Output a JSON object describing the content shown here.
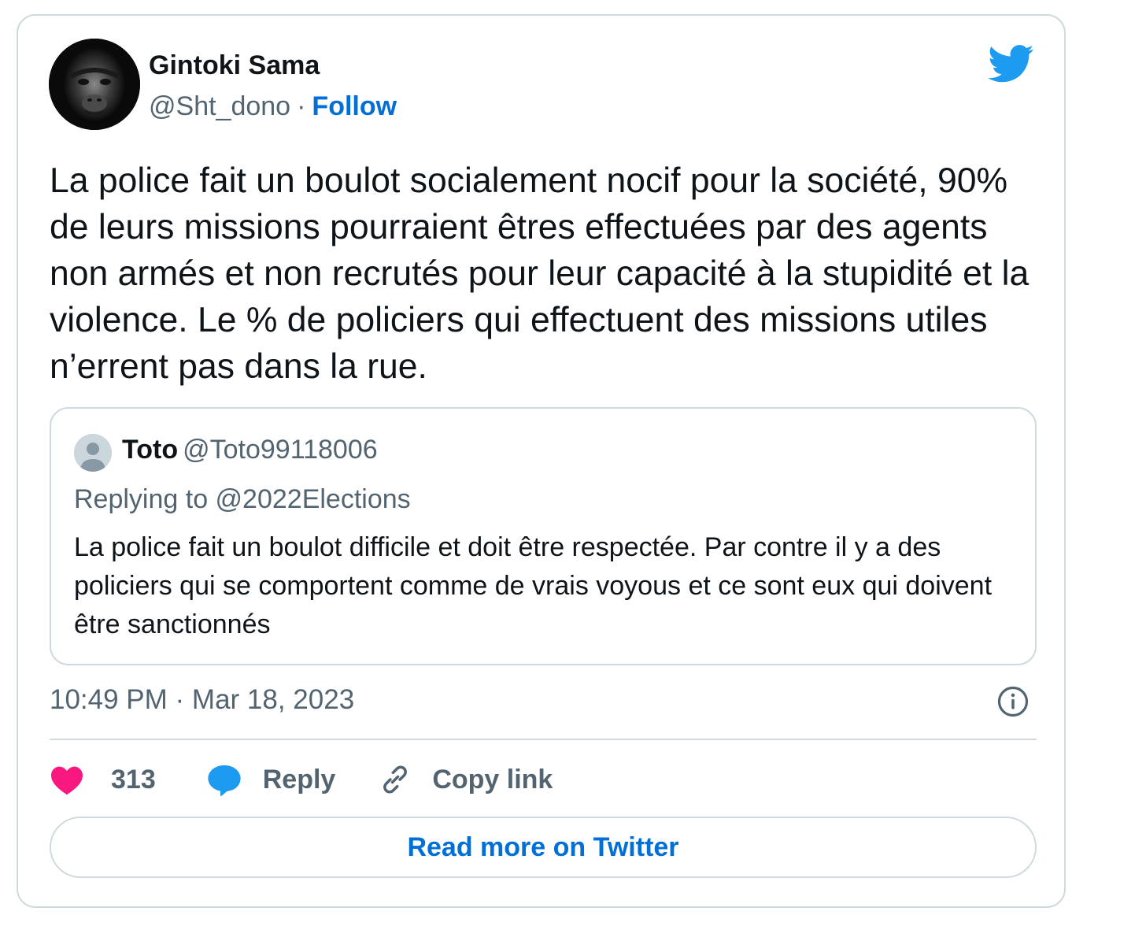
{
  "tweet": {
    "author": {
      "name": "Gintoki Sama",
      "handle": "@Sht_dono",
      "separator": "·",
      "follow_label": "Follow"
    },
    "text": "La police fait un boulot socialement nocif pour la société, 90% de leurs missions pourraient êtres effectuées par des agents non armés et non recrutés pour leur capacité à la stupidité et la violence. Le % de policiers qui effectuent des missions utiles n’errent pas dans la rue.",
    "quoted": {
      "name": "Toto",
      "handle": "@Toto99118006",
      "replying_to": "Replying to @2022Elections",
      "text": "La police fait un boulot difficile et doit être respectée. Par contre il y a des policiers qui se comportent comme de vrais voyous et ce sont eux qui doivent être sanctionnés"
    },
    "timestamp": "10:49 PM · Mar 18, 2023",
    "actions": {
      "likes": "313",
      "reply_label": "Reply",
      "copy_link_label": "Copy link"
    },
    "read_more_label": "Read more on Twitter"
  },
  "icons": {
    "brand": "twitter-bird-icon",
    "info": "info-icon",
    "like": "heart-icon",
    "reply": "speech-bubble-icon",
    "copy": "link-icon"
  },
  "colors": {
    "brand_blue": "#1d9bf0",
    "link_blue": "#006fd6",
    "like_pink": "#f91880",
    "muted_text": "#536471",
    "border": "#cfd9de"
  }
}
